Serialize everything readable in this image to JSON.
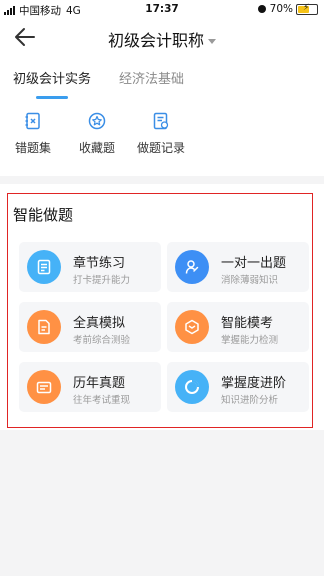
{
  "status_bar": {
    "carrier": "中国移动",
    "network": "4G",
    "time": "17:37",
    "battery": "70%",
    "battery_level": 0.7
  },
  "header": {
    "title": "初级会计职称"
  },
  "tabs": [
    {
      "label": "初级会计实务",
      "active": true
    },
    {
      "label": "经济法基础",
      "active": false
    }
  ],
  "quick_actions": [
    {
      "label": "错题集",
      "icon": "notebook-x-icon"
    },
    {
      "label": "收藏题",
      "icon": "star-circle-icon"
    },
    {
      "label": "做题记录",
      "icon": "record-list-icon"
    }
  ],
  "smart_practice": {
    "title": "智能做题",
    "items": [
      {
        "title": "章节练习",
        "subtitle": "打卡提升能力",
        "icon": "document-icon",
        "color": "#46b2f7"
      },
      {
        "title": "一对一出题",
        "subtitle": "消除薄弱知识",
        "icon": "teacher-icon",
        "color": "#3d8ff5"
      },
      {
        "title": "全真模拟",
        "subtitle": "考前综合测验",
        "icon": "exam-paper-icon",
        "color": "#ff9144"
      },
      {
        "title": "智能模考",
        "subtitle": "掌握能力检测",
        "icon": "smart-cube-icon",
        "color": "#ff9144"
      },
      {
        "title": "历年真题",
        "subtitle": "往年考试重现",
        "icon": "past-paper-icon",
        "color": "#ff9144"
      },
      {
        "title": "掌握度进阶",
        "subtitle": "知识进阶分析",
        "icon": "progress-ring-icon",
        "color": "#46b2f7"
      }
    ]
  },
  "colors": {
    "accent": "#3a9dee",
    "highlight_border": "#e02424",
    "orange": "#ff9144"
  }
}
